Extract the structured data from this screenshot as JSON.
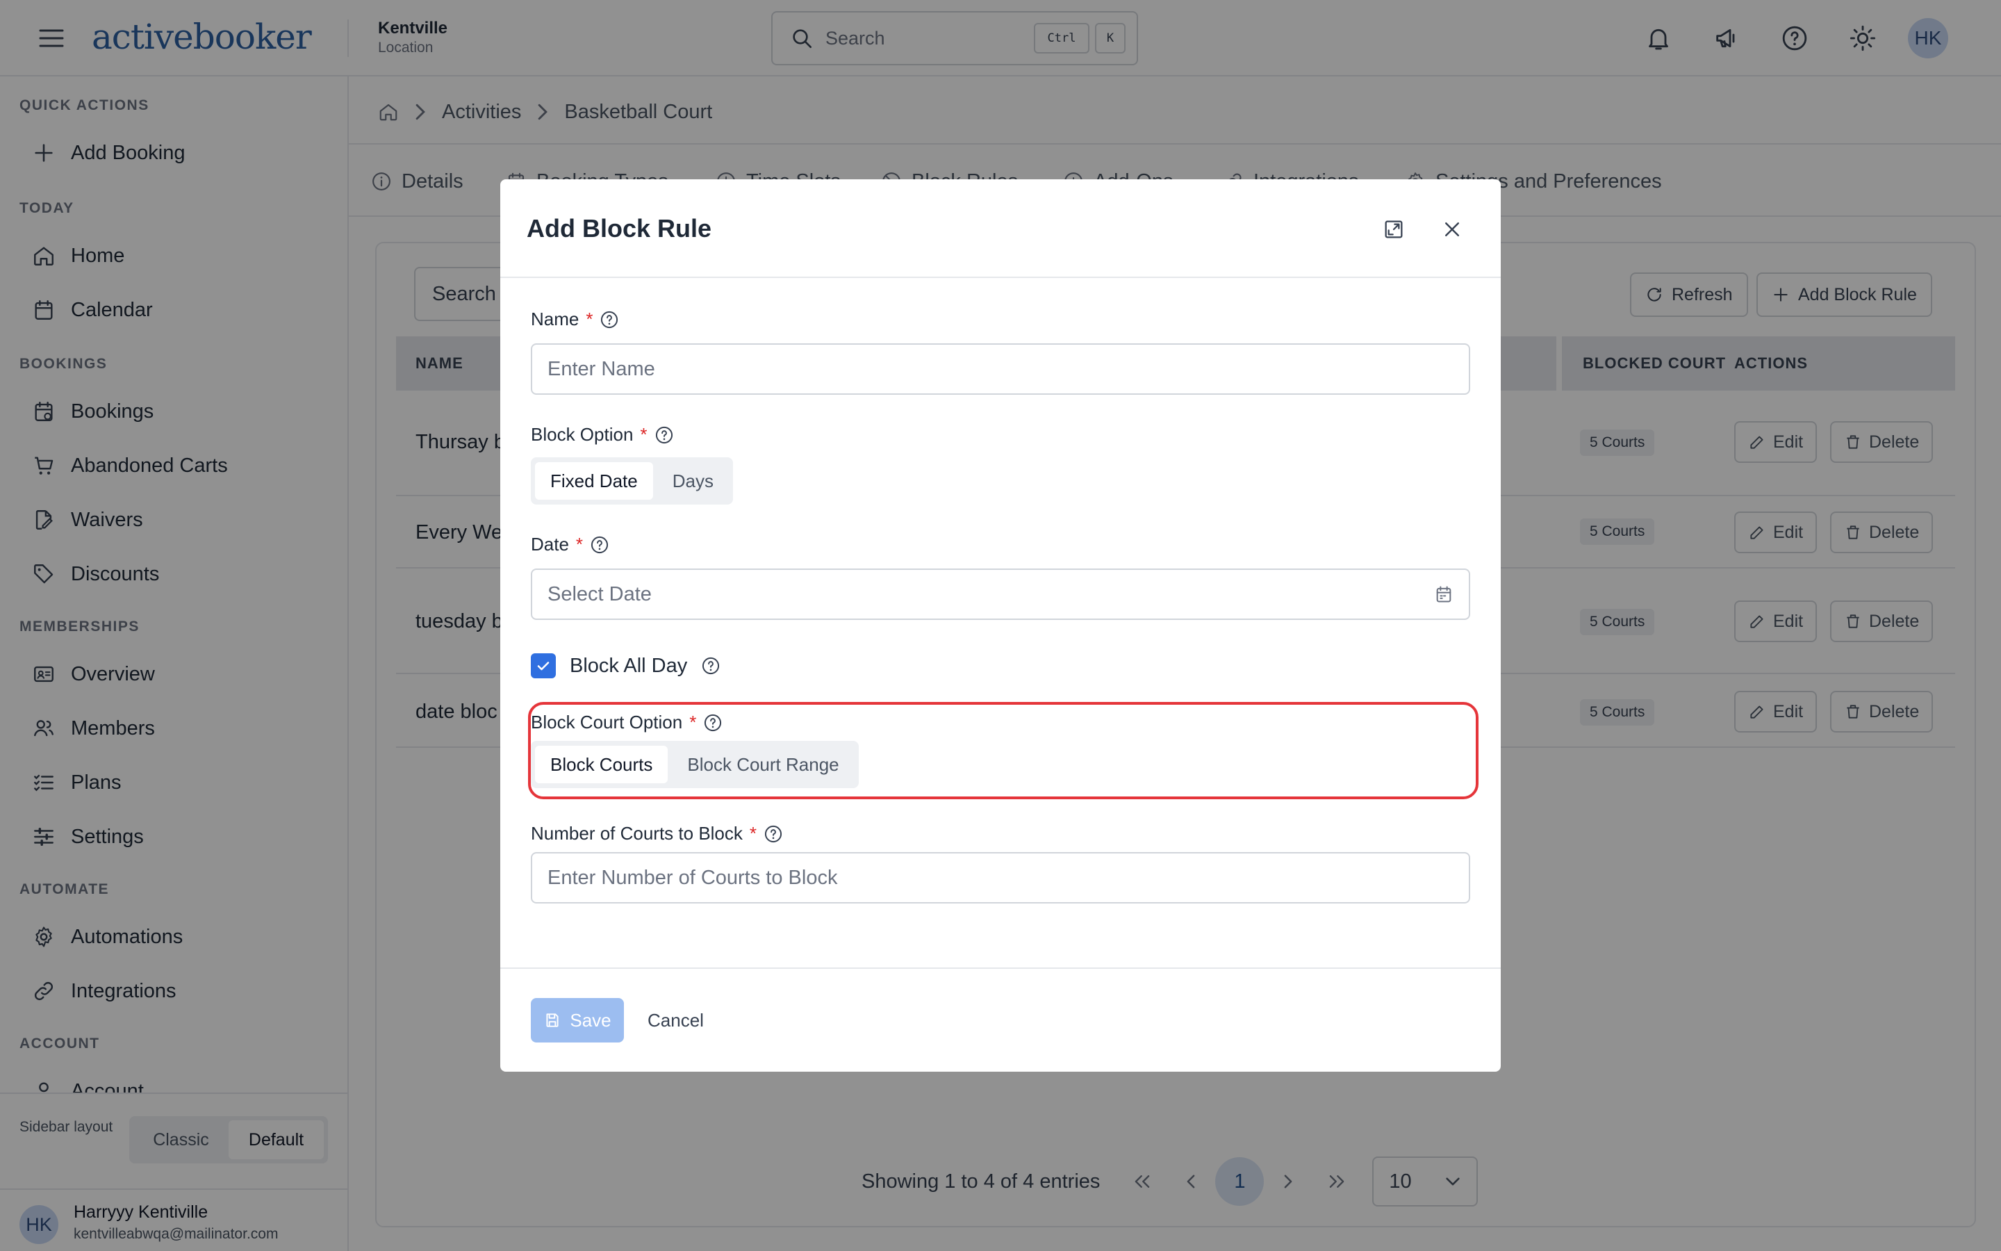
{
  "app": {
    "logo_text": "activebooker",
    "location_name": "Kentville",
    "location_label": "Location",
    "search_placeholder": "Search",
    "search_shortcut_ctrl": "Ctrl",
    "search_shortcut_key": "K",
    "user_initials": "HK"
  },
  "sidebar": {
    "sections": {
      "quick_actions": "QUICK ACTIONS",
      "today": "TODAY",
      "bookings": "BOOKINGS",
      "memberships": "MEMBERSHIPS",
      "automate": "AUTOMATE",
      "account": "ACCOUNT"
    },
    "items": {
      "add_booking": "Add Booking",
      "home": "Home",
      "calendar": "Calendar",
      "bookings": "Bookings",
      "abandoned_carts": "Abandoned Carts",
      "waivers": "Waivers",
      "discounts": "Discounts",
      "overview": "Overview",
      "members": "Members",
      "plans": "Plans",
      "settings": "Settings",
      "automations": "Automations",
      "integrations": "Integrations",
      "account": "Account"
    },
    "layout_label": "Sidebar layout",
    "layout_options": [
      "Classic",
      "Default"
    ],
    "layout_selected": "Default",
    "user": {
      "initials": "HK",
      "name": "Harryyy Kentiville",
      "email": "kentvilleabwqa@mailinator.com"
    }
  },
  "breadcrumb": [
    "Activities",
    "Basketball Court"
  ],
  "tabs": [
    "Details",
    "Booking Types",
    "Time Slots",
    "Block Rules",
    "Add-Ons",
    "Integrations",
    "Settings and Preferences"
  ],
  "table": {
    "search_placeholder": "Search",
    "refresh_label": "Refresh",
    "add_label": "Add Block Rule",
    "columns": [
      "NAME",
      "BLOCKED COURT",
      "ACTIONS"
    ],
    "rows": [
      {
        "name": "Thursay b",
        "blocked": "5 Courts"
      },
      {
        "name": "Every We",
        "blocked": "5 Courts"
      },
      {
        "name": "tuesday b",
        "blocked": "5 Courts"
      },
      {
        "name": "date bloc",
        "blocked": "5 Courts"
      }
    ],
    "edit_label": "Edit",
    "delete_label": "Delete",
    "pagination": {
      "info": "Showing 1 to 4 of 4 entries",
      "current_page": "1",
      "page_size": "10"
    }
  },
  "modal": {
    "title": "Add Block Rule",
    "name_label": "Name",
    "name_placeholder": "Enter Name",
    "block_option_label": "Block Option",
    "block_option_choices": [
      "Fixed Date",
      "Days"
    ],
    "block_option_selected": "Fixed Date",
    "date_label": "Date",
    "date_placeholder": "Select Date",
    "block_all_day_label": "Block All Day",
    "block_all_day_checked": true,
    "court_option_label": "Block Court Option",
    "court_option_choices": [
      "Block Courts",
      "Block Court Range"
    ],
    "court_option_selected": "Block Courts",
    "num_courts_label": "Number of Courts to Block",
    "num_courts_placeholder": "Enter Number of Courts to Block",
    "required_mark": "*",
    "save_label": "Save",
    "cancel_label": "Cancel"
  },
  "colors": {
    "brand": "#2c5fa0",
    "primary": "#2f6fe0",
    "save_disabled": "#9cbdf0",
    "required": "#dc2626",
    "highlight": "#e5353a"
  }
}
